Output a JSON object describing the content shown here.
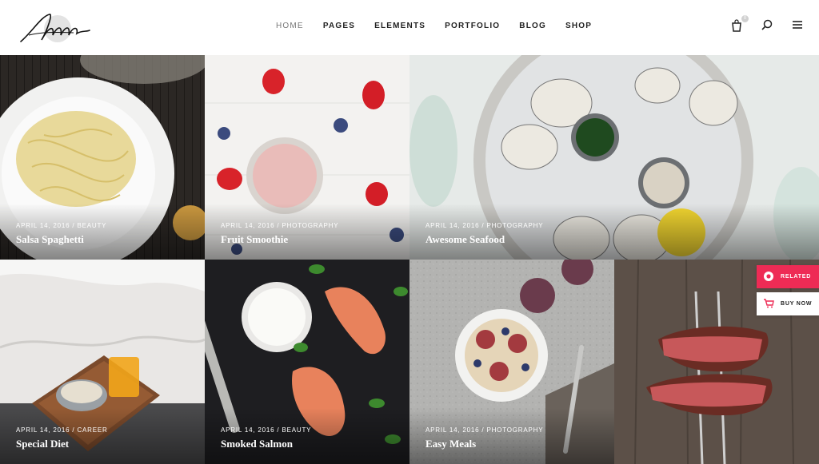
{
  "nav": {
    "items": [
      "HOME",
      "PAGES",
      "ELEMENTS",
      "PORTFOLIO",
      "BLOG",
      "SHOP"
    ],
    "active": "HOME"
  },
  "header_icons": [
    "shopping-bag-icon",
    "search-icon",
    "menu-icon"
  ],
  "cart_count": "0",
  "posts": [
    {
      "meta": "APRIL 14, 2016 / BEAUTY",
      "title": "Salsa Spaghetti"
    },
    {
      "meta": "APRIL 14, 2016 / PHOTOGRAPHY",
      "title": "Fruit Smoothie"
    },
    {
      "meta": "APRIL 14, 2016 / PHOTOGRAPHY",
      "title": "Awesome Seafood"
    },
    {
      "meta": "APRIL 14, 2016 / CAREER",
      "title": "Special Diet"
    },
    {
      "meta": "APRIL 14, 2016 / BEAUTY",
      "title": "Smoked Salmon"
    },
    {
      "meta": "APRIL 14, 2016 / PHOTOGRAPHY",
      "title": "Easy Meals"
    },
    {
      "meta": "",
      "title": ""
    }
  ],
  "side": {
    "related_label": "RELATED",
    "buy_label": "BUY NOW"
  },
  "colors": {
    "accent": "#ee2b55",
    "text_dark": "#222222"
  }
}
